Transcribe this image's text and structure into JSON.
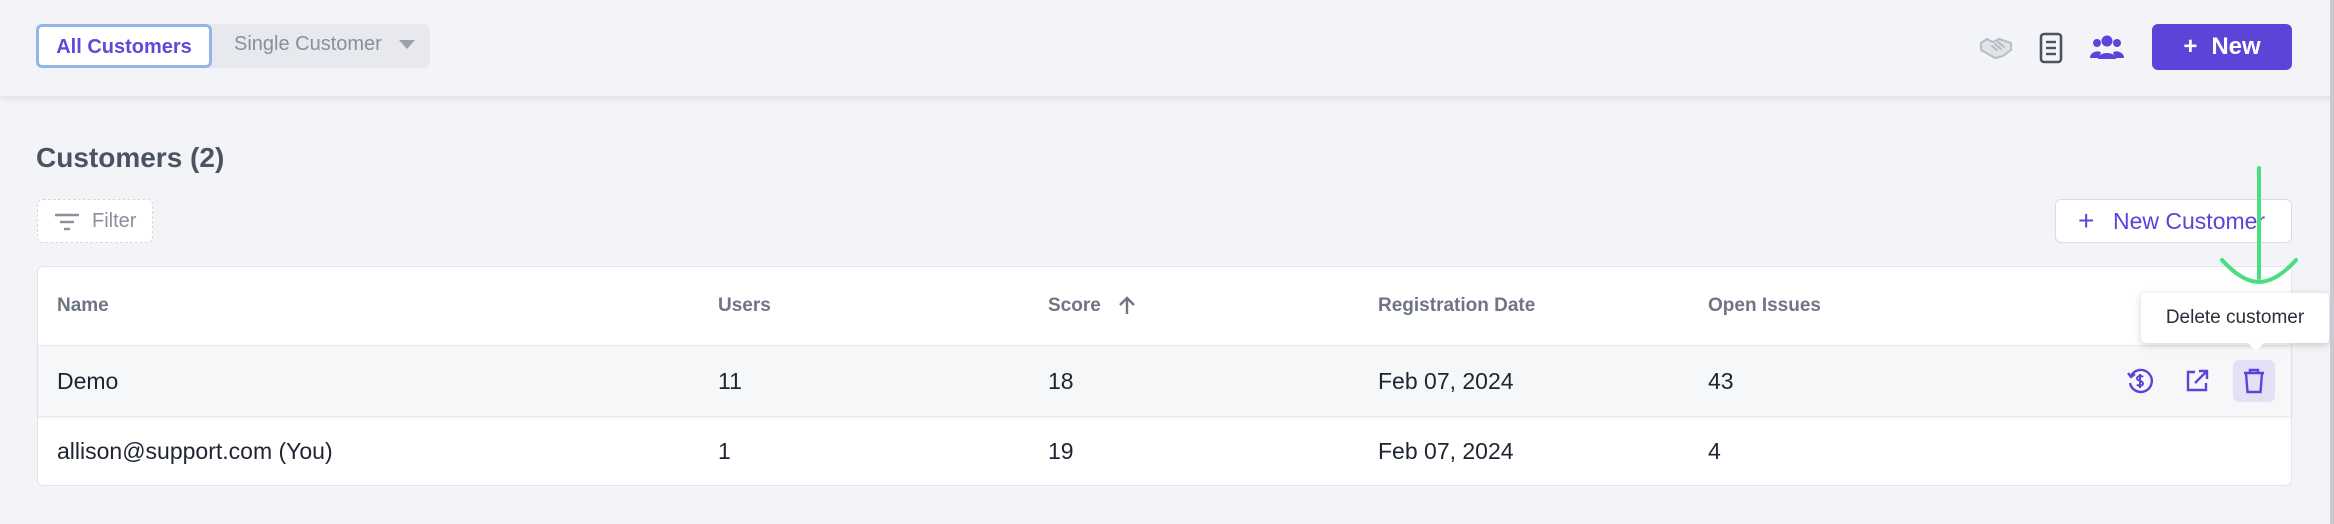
{
  "header": {
    "tabs": [
      {
        "label": "All Customers",
        "active": true
      },
      {
        "label": "Single Customer",
        "active": false
      }
    ],
    "icons": [
      "handshake-icon",
      "document-icon",
      "users-icon"
    ],
    "new_button": "New",
    "new_button_plus": "+"
  },
  "page": {
    "title": "Customers (2)",
    "filter_label": "Filter",
    "new_customer_label": "New Customer",
    "new_customer_plus": "+"
  },
  "table": {
    "columns": [
      "Name",
      "Users",
      "Score",
      "Registration Date",
      "Open Issues"
    ],
    "sort": {
      "column": "Score",
      "direction": "ascending"
    },
    "rows": [
      {
        "name": "Demo",
        "users": "11",
        "score": "18",
        "date": "Feb 07, 2024",
        "issues": "43"
      },
      {
        "name": "allison@support.com (You)",
        "users": "1",
        "score": "19",
        "date": "Feb 07, 2024",
        "issues": "4"
      }
    ]
  },
  "tooltip": {
    "text": "Delete customer"
  },
  "colors": {
    "accent": "#5b44d8",
    "background": "#f3f4f7",
    "annotation": "#4ade80"
  }
}
